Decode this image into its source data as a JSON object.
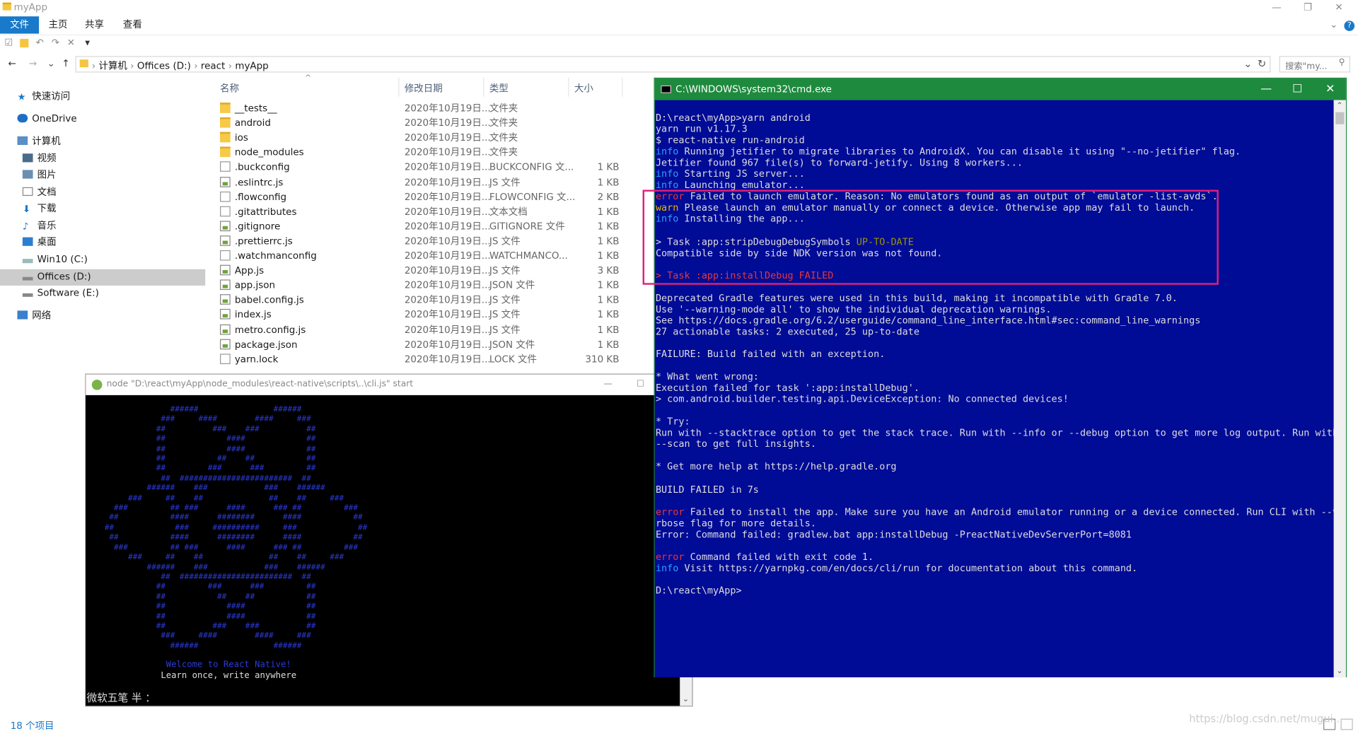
{
  "explorer": {
    "title": "myApp",
    "ribbon_tabs": [
      "文件",
      "主页",
      "共享",
      "查看"
    ],
    "breadcrumb": [
      "计算机",
      "Offices (D:)",
      "react",
      "myApp"
    ],
    "search_placeholder": "搜索\"my...",
    "nav": [
      "快速访问",
      "OneDrive",
      "计算机",
      "视频",
      "图片",
      "文档",
      "下载",
      "音乐",
      "桌面",
      "Win10 (C:)",
      "Offices (D:)",
      "Software (E:)",
      "网络"
    ],
    "columns": [
      "名称",
      "修改日期",
      "类型",
      "大小"
    ],
    "files": [
      {
        "name": "__tests__",
        "date": "2020年10月19日...",
        "type": "文件夹",
        "size": "",
        "kind": "folder"
      },
      {
        "name": "android",
        "date": "2020年10月19日...",
        "type": "文件夹",
        "size": "",
        "kind": "folder"
      },
      {
        "name": "ios",
        "date": "2020年10月19日...",
        "type": "文件夹",
        "size": "",
        "kind": "folder"
      },
      {
        "name": "node_modules",
        "date": "2020年10月19日...",
        "type": "文件夹",
        "size": "",
        "kind": "folder"
      },
      {
        "name": ".buckconfig",
        "date": "2020年10月19日...",
        "type": "BUCKCONFIG 文...",
        "size": "1 KB",
        "kind": "file"
      },
      {
        "name": ".eslintrc.js",
        "date": "2020年10月19日...",
        "type": "JS 文件",
        "size": "1 KB",
        "kind": "js"
      },
      {
        "name": ".flowconfig",
        "date": "2020年10月19日...",
        "type": "FLOWCONFIG 文...",
        "size": "2 KB",
        "kind": "file"
      },
      {
        "name": ".gitattributes",
        "date": "2020年10月19日...",
        "type": "文本文档",
        "size": "1 KB",
        "kind": "file"
      },
      {
        "name": ".gitignore",
        "date": "2020年10月19日...",
        "type": "GITIGNORE 文件",
        "size": "1 KB",
        "kind": "js"
      },
      {
        "name": ".prettierrc.js",
        "date": "2020年10月19日...",
        "type": "JS 文件",
        "size": "1 KB",
        "kind": "js"
      },
      {
        "name": ".watchmanconfig",
        "date": "2020年10月19日...",
        "type": "WATCHMANCO...",
        "size": "1 KB",
        "kind": "file"
      },
      {
        "name": "App.js",
        "date": "2020年10月19日...",
        "type": "JS 文件",
        "size": "3 KB",
        "kind": "js"
      },
      {
        "name": "app.json",
        "date": "2020年10月19日...",
        "type": "JSON 文件",
        "size": "1 KB",
        "kind": "js"
      },
      {
        "name": "babel.config.js",
        "date": "2020年10月19日...",
        "type": "JS 文件",
        "size": "1 KB",
        "kind": "js"
      },
      {
        "name": "index.js",
        "date": "2020年10月19日...",
        "type": "JS 文件",
        "size": "1 KB",
        "kind": "js"
      },
      {
        "name": "metro.config.js",
        "date": "2020年10月19日...",
        "type": "JS 文件",
        "size": "1 KB",
        "kind": "js"
      },
      {
        "name": "package.json",
        "date": "2020年10月19日...",
        "type": "JSON 文件",
        "size": "1 KB",
        "kind": "js"
      },
      {
        "name": "yarn.lock",
        "date": "2020年10月19日...",
        "type": "LOCK 文件",
        "size": "310 KB",
        "kind": "file"
      }
    ],
    "status": "18 个项目"
  },
  "node_window": {
    "title": "node  \"D:\\react\\myApp\\node_modules\\react-native\\scripts\\..\\cli.js\" start",
    "ascii_art": "                  ######                ######\n                ###     ####        ####     ###\n               ##          ###    ###          ##\n               ##             ####             ##\n               ##             ####             ##\n               ##           ##    ##           ##\n               ##         ###      ###         ##\n                ##  ########################  ##\n             ######    ###            ###    ######\n         ###     ##    ##              ##    ##     ###\n      ###         ## ###      ####      ### ##         ###\n     ##           ####      ########      ####           ##\n    ##             ###     ##########     ###             ##\n     ##           ####      ########      ####           ##\n      ###         ## ###      ####      ### ##         ###\n         ###     ##    ##              ##    ##     ###\n             ######    ###            ###    ######\n                ##  ########################  ##\n               ##         ###      ###         ##\n               ##           ##    ##           ##\n               ##             ####             ##\n               ##             ####             ##\n               ##          ###    ###          ##\n                ###     ####        ####     ###\n                  ######                ######",
    "welcome": "Welcome to React Native!",
    "tagline": "Learn once, write anywhere",
    "ime": "微软五笔 半 ："
  },
  "cmd_window": {
    "title": "C:\\WINDOWS\\system32\\cmd.exe",
    "lines": [
      [
        [
          "",
          "D:\\react\\myApp>yarn android"
        ]
      ],
      [
        [
          "",
          "yarn run v1.17.3"
        ]
      ],
      [
        [
          "",
          "$ react-native run-android"
        ]
      ],
      [
        [
          "c-info",
          "info"
        ],
        [
          "",
          " Running "
        ],
        [
          "",
          "jetifier"
        ],
        [
          "",
          " to migrate libraries to AndroidX. You can disable it using \"--no-jetifier\" flag."
        ]
      ],
      [
        [
          "",
          "Jetifier found 967 file(s) to forward-jetify. Using 8 workers..."
        ]
      ],
      [
        [
          "c-info",
          "info"
        ],
        [
          "",
          " Starting JS server..."
        ]
      ],
      [
        [
          "c-info",
          "info"
        ],
        [
          "",
          " Launching emulator..."
        ]
      ],
      [
        [
          "c-err",
          "error"
        ],
        [
          "",
          " Failed to launch emulator. Reason: No emulators found as an output of `emulator -list-avds`."
        ]
      ],
      [
        [
          "c-warn",
          "warn"
        ],
        [
          "",
          " Please launch an emulator manually or connect a device. Otherwise app may fail to launch."
        ]
      ],
      [
        [
          "c-info",
          "info"
        ],
        [
          "",
          " Installing the app..."
        ]
      ],
      [
        [
          "",
          ""
        ]
      ],
      [
        [
          "",
          "> Task :app:stripDebugDebugSymbols "
        ],
        [
          "c-yel",
          "UP-TO-DATE"
        ]
      ],
      [
        [
          "",
          "Compatible side by side NDK version was not found."
        ]
      ],
      [
        [
          "",
          ""
        ]
      ],
      [
        [
          "c-err",
          "> Task :app:installDebug FAILED"
        ]
      ],
      [
        [
          "",
          ""
        ]
      ],
      [
        [
          "",
          "Deprecated Gradle features were used in this build, making it incompatible with Gradle 7.0."
        ]
      ],
      [
        [
          "",
          "Use '--warning-mode all' to show the individual deprecation warnings."
        ]
      ],
      [
        [
          "",
          "See https://docs.gradle.org/6.2/userguide/command_line_interface.html#sec:command_line_warnings"
        ]
      ],
      [
        [
          "",
          "27 actionable tasks: 2 executed, 25 up-to-date"
        ]
      ],
      [
        [
          "",
          ""
        ]
      ],
      [
        [
          "",
          "FAILURE: Build failed with an exception."
        ]
      ],
      [
        [
          "",
          ""
        ]
      ],
      [
        [
          "",
          "* What went wrong:"
        ]
      ],
      [
        [
          "",
          "Execution failed for task ':app:installDebug'."
        ]
      ],
      [
        [
          "",
          "> com.android.builder.testing.api.DeviceException: No connected devices!"
        ]
      ],
      [
        [
          "",
          ""
        ]
      ],
      [
        [
          "",
          "* Try:"
        ]
      ],
      [
        [
          "",
          "Run with --stacktrace option to get the stack trace. Run with --info or --debug option to get more log output. Run with"
        ]
      ],
      [
        [
          "",
          "--scan to get full insights."
        ]
      ],
      [
        [
          "",
          ""
        ]
      ],
      [
        [
          "",
          "* Get more help at https://help.gradle.org"
        ]
      ],
      [
        [
          "",
          ""
        ]
      ],
      [
        [
          "",
          "BUILD FAILED in 7s"
        ]
      ],
      [
        [
          "",
          ""
        ]
      ],
      [
        [
          "c-err",
          "error"
        ],
        [
          "",
          " Failed to install the app. Make sure you have an Android emulator running or a device connected. Run CLI with --ve"
        ]
      ],
      [
        [
          "",
          "rbose flag for more details."
        ]
      ],
      [
        [
          "",
          "Error: Command failed: gradlew.bat app:installDebug -PreactNativeDevServerPort=8081"
        ]
      ],
      [
        [
          "",
          ""
        ]
      ],
      [
        [
          "c-err",
          "error"
        ],
        [
          "",
          " Command failed with exit code 1."
        ]
      ],
      [
        [
          "c-info",
          "info"
        ],
        [
          "",
          " Visit https://yarnpkg.com/en/docs/cli/run for documentation about this command."
        ]
      ],
      [
        [
          "",
          ""
        ]
      ],
      [
        [
          "",
          "D:\\react\\myApp>"
        ]
      ]
    ]
  },
  "watermark": "https://blog.csdn.net/mugui..."
}
